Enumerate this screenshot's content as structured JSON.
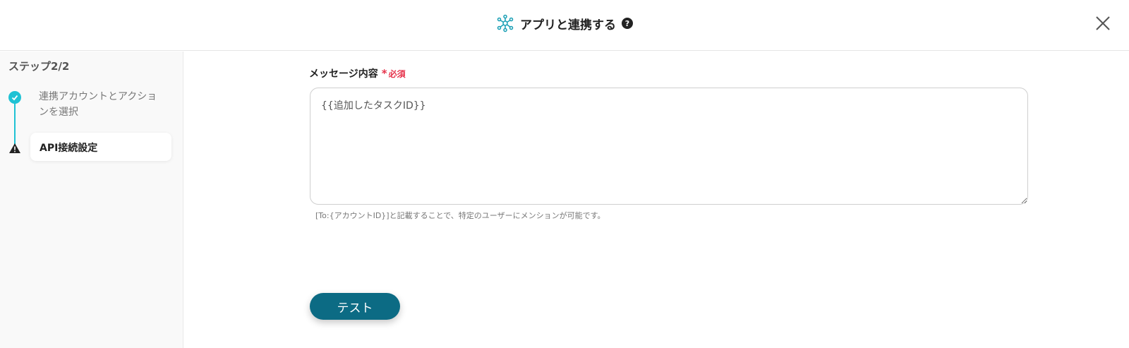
{
  "header": {
    "title": "アプリと連携する",
    "help_icon": "question-circle-icon",
    "app_icon": "network-nodes-icon",
    "close_icon": "close-icon"
  },
  "sidebar": {
    "step_heading": "ステップ2/2",
    "steps": [
      {
        "label": "連携アカウントとアクションを選択",
        "status": "completed",
        "icon": "check-circle-icon"
      },
      {
        "label": "API接続設定",
        "status": "current-warning",
        "icon": "warning-icon"
      }
    ]
  },
  "form": {
    "message_label": "メッセージ内容",
    "required_mark": "*",
    "required_text": "必須",
    "message_value": "{{追加したタスクID}}",
    "hint": "[To:{アカウントID}]と記載することで、特定のユーザーにメンションが可能です。"
  },
  "actions": {
    "test_label": "テスト"
  },
  "colors": {
    "accent": "#1fc2d4",
    "primary_button": "#0c6b84",
    "required": "#e6344c"
  }
}
